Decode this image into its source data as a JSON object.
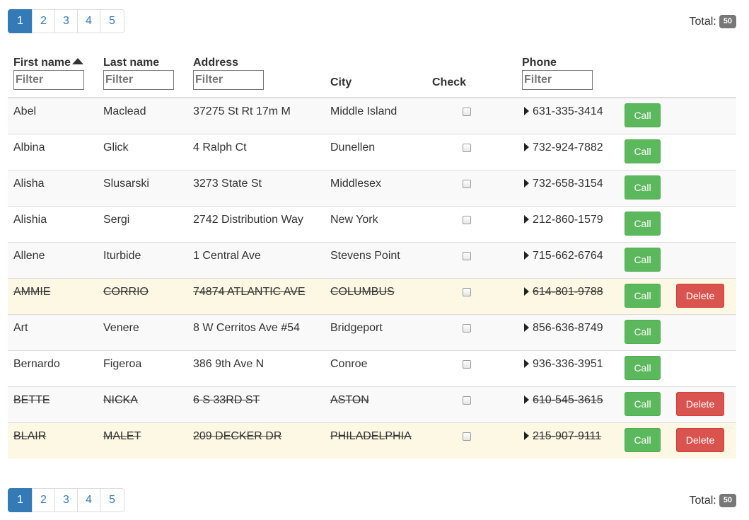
{
  "pagination": {
    "pages": [
      "1",
      "2",
      "3",
      "4",
      "5"
    ],
    "active_page": "1"
  },
  "total": {
    "label": "Total:",
    "count": "50"
  },
  "columns": {
    "first_name": "First name",
    "last_name": "Last name",
    "address": "Address",
    "city": "City",
    "check": "Check",
    "phone": "Phone",
    "filter_placeholder": "Filter"
  },
  "sort": {
    "column": "first_name",
    "direction": "ascending"
  },
  "actions": {
    "call_label": "Call",
    "delete_label": "Delete"
  },
  "rows": [
    {
      "first": "Abel",
      "last": "Maclead",
      "address": "37275 St Rt 17m M",
      "city": "Middle Island",
      "phone": "631-335-3414",
      "struck": false
    },
    {
      "first": "Albina",
      "last": "Glick",
      "address": "4 Ralph Ct",
      "city": "Dunellen",
      "phone": "732-924-7882",
      "struck": false
    },
    {
      "first": "Alisha",
      "last": "Slusarski",
      "address": "3273 State St",
      "city": "Middlesex",
      "phone": "732-658-3154",
      "struck": false
    },
    {
      "first": "Alishia",
      "last": "Sergi",
      "address": "2742 Distribution Way",
      "city": "New York",
      "phone": "212-860-1579",
      "struck": false
    },
    {
      "first": "Allene",
      "last": "Iturbide",
      "address": "1 Central Ave",
      "city": "Stevens Point",
      "phone": "715-662-6764",
      "struck": false
    },
    {
      "first": "Ammie",
      "last": "Corrio",
      "address": "74874 Atlantic Ave",
      "city": "Columbus",
      "phone": "614-801-9788",
      "struck": true
    },
    {
      "first": "Art",
      "last": "Venere",
      "address": "8 W Cerritos Ave #54",
      "city": "Bridgeport",
      "phone": "856-636-8749",
      "struck": false
    },
    {
      "first": "Bernardo",
      "last": "Figeroa",
      "address": "386 9th Ave N",
      "city": "Conroe",
      "phone": "936-336-3951",
      "struck": false
    },
    {
      "first": "Bette",
      "last": "Nicka",
      "address": "6 S 33rd St",
      "city": "Aston",
      "phone": "610-545-3615",
      "struck": true
    },
    {
      "first": "Blair",
      "last": "Malet",
      "address": "209 Decker Dr",
      "city": "Philadelphia",
      "phone": "215-907-9111",
      "struck": true
    }
  ],
  "colors": {
    "primary": "#337ab7",
    "call_button": "#5cb85c",
    "delete_button": "#d9534f",
    "warning_row": "#fcf8e3",
    "striped_row": "#f9f9f9",
    "badge": "#777777"
  }
}
